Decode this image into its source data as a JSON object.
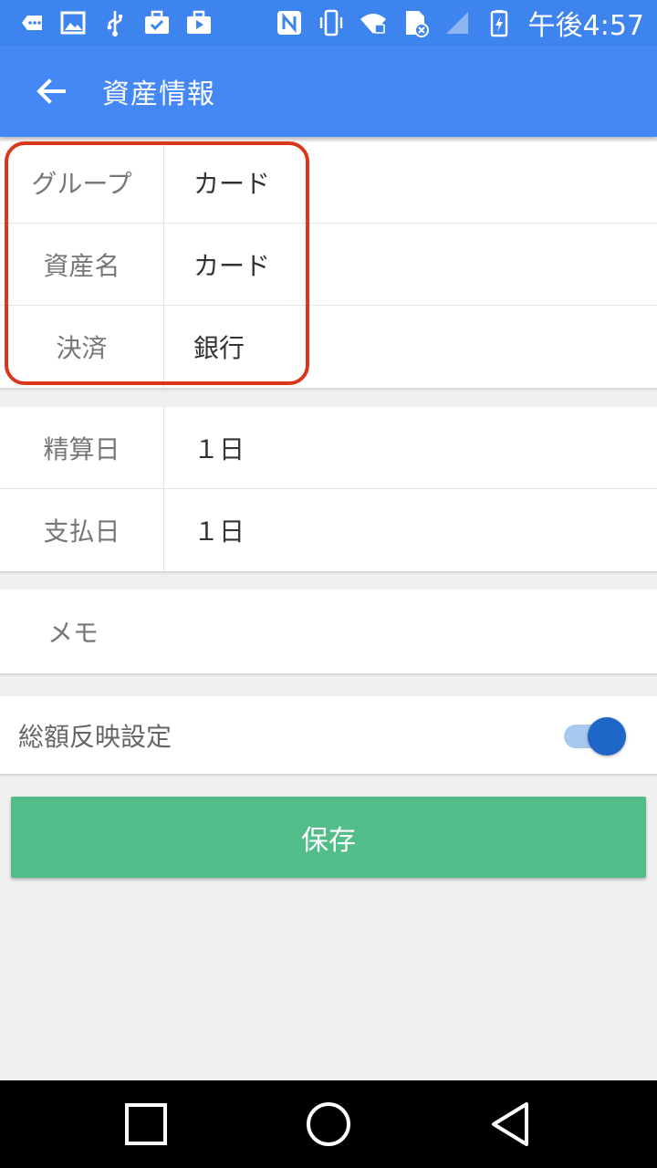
{
  "status_bar": {
    "time": "午後4:57",
    "icons": [
      "overflow-icon",
      "image-icon",
      "usb-icon",
      "briefcase-check-icon",
      "briefcase-play-icon",
      "nfc-icon",
      "vibrate-icon",
      "wifi-icon",
      "sim-icon",
      "signal-icon",
      "battery-charging-icon"
    ]
  },
  "app_bar": {
    "title": "資産情報",
    "back_icon": "arrow-back-icon"
  },
  "section1": [
    {
      "label": "グループ",
      "value": "カード"
    },
    {
      "label": "資産名",
      "value": "カード"
    },
    {
      "label": "決済",
      "value": "銀行"
    }
  ],
  "section2": [
    {
      "label": "精算日",
      "value": "１日"
    },
    {
      "label": "支払日",
      "value": "１日"
    }
  ],
  "memo": {
    "placeholder": "メモ"
  },
  "total_reflect": {
    "label": "総額反映設定",
    "enabled": true
  },
  "save_button": {
    "label": "保存"
  },
  "colors": {
    "status_bar": "#3d84ee",
    "app_bar": "#4488f5",
    "save_button": "#52bd89",
    "toggle_thumb": "#1e66c8",
    "highlight": "#d9371c"
  }
}
